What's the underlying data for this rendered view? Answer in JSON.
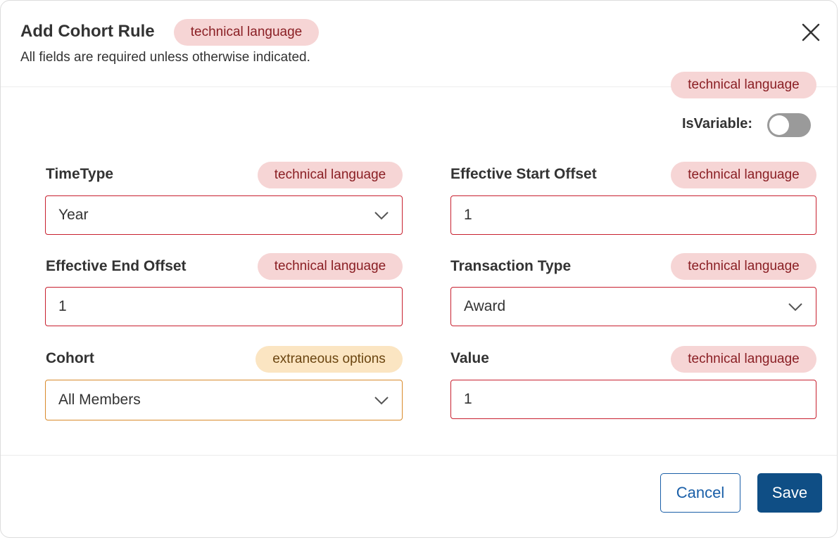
{
  "modal": {
    "title": "Add Cohort Rule",
    "subtitle": "All fields are required unless otherwise indicated.",
    "title_badge": "technical language",
    "close_icon": "close-icon"
  },
  "toggle": {
    "badge": "technical language",
    "label": "IsVariable:",
    "state": "off"
  },
  "fields": {
    "time_type": {
      "label": "TimeType",
      "badge": "technical language",
      "value": "Year"
    },
    "effective_start_offset": {
      "label": "Effective Start Offset",
      "badge": "technical language",
      "value": "1"
    },
    "effective_end_offset": {
      "label": "Effective End Offset",
      "badge": "technical language",
      "value": "1"
    },
    "transaction_type": {
      "label": "Transaction Type",
      "badge": "technical language",
      "value": "Award"
    },
    "cohort": {
      "label": "Cohort",
      "badge": "extraneous options",
      "value": "All Members"
    },
    "value": {
      "label": "Value",
      "badge": "technical language",
      "value": "1"
    }
  },
  "footer": {
    "cancel_label": "Cancel",
    "save_label": "Save"
  },
  "colors": {
    "error_border": "#c8202f",
    "warning_border": "#d98a2b",
    "tech_badge_bg": "#f6d5d5",
    "tech_badge_text": "#8a1f24",
    "extra_badge_bg": "#fbe5c2",
    "extra_badge_text": "#6b4510",
    "primary": "#0f4e85",
    "link": "#1a5fa8"
  }
}
